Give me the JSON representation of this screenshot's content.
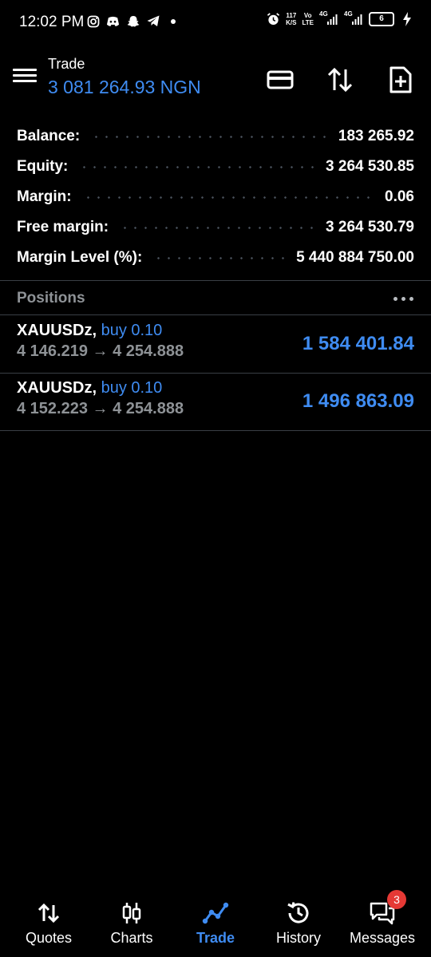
{
  "status_bar": {
    "time": "12:02 PM",
    "net_speed_top": "117",
    "net_speed_bottom": "K/S",
    "volte_top": "Vo",
    "volte_bottom": "LTE",
    "sim1": "4G",
    "sim2": "4G",
    "battery": "6"
  },
  "header": {
    "title": "Trade",
    "balance_line": "3 081 264.93 NGN",
    "icons": [
      "menu-icon",
      "card-icon",
      "sort-icon",
      "new-order-icon"
    ]
  },
  "summary": [
    {
      "label": "Balance:",
      "value": "183 265.92"
    },
    {
      "label": "Equity:",
      "value": "3 264 530.85"
    },
    {
      "label": "Margin:",
      "value": "0.06"
    },
    {
      "label": "Free margin:",
      "value": "3 264 530.79"
    },
    {
      "label": "Margin Level (%):",
      "value": "5 440 884 750.00"
    }
  ],
  "positions": {
    "label": "Positions",
    "items": [
      {
        "symbol": "XAUUSDz,",
        "side": "buy 0.10",
        "prices": "4 146.219 → 4 254.888",
        "profit": "1 584 401.84"
      },
      {
        "symbol": "XAUUSDz,",
        "side": "buy 0.10",
        "prices": "4 152.223 → 4 254.888",
        "profit": "1 496 863.09"
      }
    ]
  },
  "bottom_nav": [
    {
      "label": "Quotes",
      "icon": "quotes-icon",
      "active": false
    },
    {
      "label": "Charts",
      "icon": "charts-icon",
      "active": false
    },
    {
      "label": "Trade",
      "icon": "trade-icon",
      "active": true
    },
    {
      "label": "History",
      "icon": "history-icon",
      "active": false
    },
    {
      "label": "Messages",
      "icon": "messages-icon",
      "active": false,
      "badge": "3"
    }
  ],
  "colors": {
    "accent": "#3f8cf2",
    "muted": "#8e9296",
    "background": "#000000",
    "badge": "#e53935"
  }
}
